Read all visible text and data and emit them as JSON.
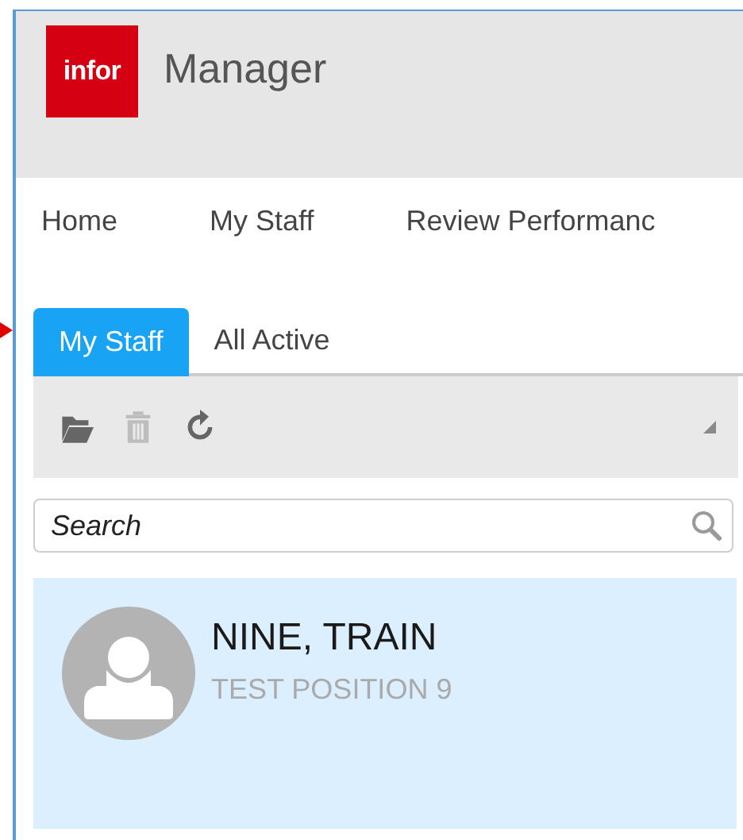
{
  "app": {
    "logo": "infor",
    "title": "Manager"
  },
  "nav": [
    {
      "label": "Home"
    },
    {
      "label": "My Staff"
    },
    {
      "label": "Review Performanc"
    }
  ],
  "tabs": [
    {
      "label": "My Staff",
      "selected": true
    },
    {
      "label": "All Active",
      "selected": false
    }
  ],
  "toolbar": [
    {
      "kind": "open",
      "disabled": false
    },
    {
      "kind": "delete",
      "disabled": true
    },
    {
      "kind": "refresh",
      "disabled": false
    }
  ],
  "search": {
    "placeholder": "Search"
  },
  "staff": [
    {
      "name": "NINE, TRAIN",
      "position": "TEST POSITION 9",
      "selected": true
    }
  ]
}
